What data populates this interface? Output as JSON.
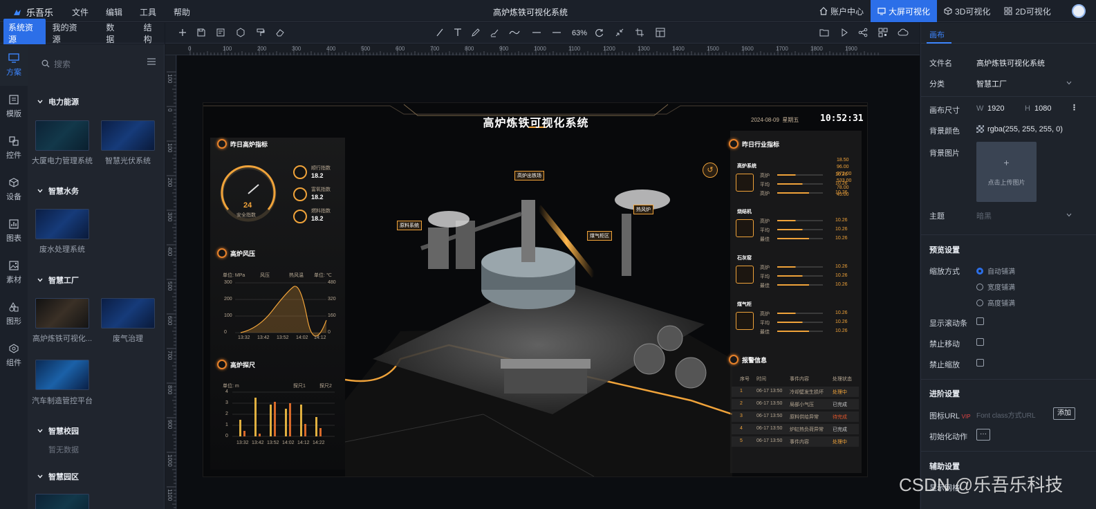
{
  "app": {
    "logo_text": "乐吾乐",
    "title": "高炉炼铁可视化系统"
  },
  "menu": [
    "文件",
    "编辑",
    "工具",
    "帮助"
  ],
  "top_right": {
    "account": "账户中心",
    "bigscreen": "大屏可视化",
    "v3d": "3D可视化",
    "v2d": "2D可视化"
  },
  "left_tabs": [
    "系统资源",
    "我的资源",
    "数据",
    "结构"
  ],
  "rail": [
    "方案",
    "模版",
    "控件",
    "设备",
    "图表",
    "素材",
    "图形",
    "组件"
  ],
  "search": {
    "placeholder": "搜索"
  },
  "categories": {
    "power": {
      "name": "电力能源",
      "items": [
        "大厦电力管理系统",
        "智慧光伏系统"
      ]
    },
    "water": {
      "name": "智慧水务",
      "items": [
        "废水处理系统"
      ]
    },
    "factory": {
      "name": "智慧工厂",
      "items": [
        "高炉炼铁可视化...",
        "废气治理",
        "汽车制造管控平台"
      ]
    },
    "campus": {
      "name": "智慧校园",
      "empty": "暂无数据"
    },
    "park": {
      "name": "智慧园区"
    }
  },
  "toolbar": {
    "zoom": "63%"
  },
  "ruler": {
    "h": [
      "0",
      "100",
      "200",
      "300",
      "400",
      "500",
      "600",
      "700",
      "800",
      "900",
      "1000",
      "1100",
      "1200",
      "1300",
      "1400",
      "1500",
      "1600",
      "1700",
      "1800",
      "1900"
    ],
    "v": [
      "100",
      "0",
      "100",
      "200",
      "300",
      "400",
      "500",
      "600",
      "700",
      "800",
      "900",
      "1000",
      "1100"
    ]
  },
  "dashboard": {
    "title": "高炉炼铁可视化系统",
    "date": "2024-08-09",
    "weekday": "星期五",
    "time": "10:52:31",
    "p1": {
      "title": "昨日高炉指标",
      "gauge_value": "24",
      "gauge_label": "安全指数",
      "metrics": [
        {
          "label": "顺行指数",
          "value": "18.2"
        },
        {
          "label": "富氧指数",
          "value": "18.2"
        },
        {
          "label": "燃料指数",
          "value": "18.2"
        }
      ]
    },
    "p2": {
      "title": "高炉风压",
      "unit_left": "单位: MPa",
      "unit_right": "单位: ℃",
      "legend": [
        "风压",
        "热风温"
      ],
      "yleft": [
        "300",
        "200",
        "100",
        "0"
      ],
      "yright": [
        "480",
        "320",
        "160",
        "0"
      ],
      "x": [
        "13:32",
        "13:42",
        "13:52",
        "14:02",
        "14:12"
      ]
    },
    "p3": {
      "title": "高炉探尺",
      "unit": "单位: m",
      "legend": [
        "探尺1",
        "探尺2"
      ],
      "y": [
        "4",
        "3",
        "2",
        "1",
        "0"
      ],
      "x": [
        "13:32",
        "13:42",
        "13:52",
        "14:02",
        "14:12",
        "14:22"
      ]
    },
    "right": {
      "title": "昨日行业指标",
      "groups": [
        {
          "name": "高炉系统",
          "rows": [
            {
              "k": "高炉",
              "v": "10.26"
            },
            {
              "k": "平均",
              "v": "10.26"
            },
            {
              "k": "高炉",
              "v": "10.26"
            }
          ]
        },
        {
          "name": "烧结机",
          "rows": [
            {
              "k": "高炉",
              "v": "10.26"
            },
            {
              "k": "平均",
              "v": "10.26"
            },
            {
              "k": "最佳",
              "v": "10.26"
            }
          ]
        },
        {
          "name": "石灰窑",
          "rows": [
            {
              "k": "高炉",
              "v": "10.26"
            },
            {
              "k": "平均",
              "v": "10.26"
            },
            {
              "k": "最佳",
              "v": "10.26"
            }
          ]
        },
        {
          "name": "煤气柜",
          "rows": [
            {
              "k": "高炉",
              "v": "10.26"
            },
            {
              "k": "平均",
              "v": "10.26"
            },
            {
              "k": "最佳",
              "v": "10.26"
            }
          ]
        }
      ],
      "side_values": [
        "18.50",
        "96.00",
        "972.00",
        "533.00",
        "78.00",
        "45.00"
      ]
    },
    "alarm": {
      "title": "报警信息",
      "headers": [
        "序号",
        "时间",
        "事件内容",
        "处理状态"
      ],
      "rows": [
        {
          "n": "1",
          "t": "06-17 13:50",
          "c": "冷却壁发生损坏",
          "s": "处理中"
        },
        {
          "n": "2",
          "t": "06-17 13:50",
          "c": "局部小气压",
          "s": "已完成"
        },
        {
          "n": "3",
          "t": "06-17 13:50",
          "c": "原料供给异常",
          "s": "待完成"
        },
        {
          "n": "4",
          "t": "06-17 13:50",
          "c": "炉缸热负荷异常",
          "s": "已完成"
        },
        {
          "n": "5",
          "t": "06-17 13:50",
          "c": "事件内容",
          "s": "处理中"
        }
      ]
    },
    "labels": [
      "高炉出铁场",
      "热风炉",
      "原料系统",
      "煤气柜区"
    ]
  },
  "props": {
    "tab": "画布",
    "file_label": "文件名",
    "file_value": "高炉炼铁可视化系统",
    "cat_label": "分类",
    "cat_value": "智慧工厂",
    "size_label": "画布尺寸",
    "w_label": "W",
    "w_value": "1920",
    "h_label": "H",
    "h_value": "1080",
    "bg_label": "背景颜色",
    "bg_value": "rgba(255, 255, 255, 0)",
    "bgimg_label": "背景图片",
    "upload_text": "点击上传图片",
    "theme_label": "主题",
    "theme_value": "暗黑",
    "preview": "预览设置",
    "scale_label": "缩放方式",
    "scale_options": [
      "自动铺满",
      "宽度铺满",
      "高度铺满"
    ],
    "scroll_label": "显示滚动条",
    "nomove_label": "禁止移动",
    "nozoom_label": "禁止缩放",
    "advanced": "进阶设置",
    "icon_url_label": "图标URL",
    "vip": "VIP",
    "icon_url_placeholder": "Font class方式URL",
    "add": "添加",
    "init_label": "初始化动作",
    "more": "···",
    "aux": "辅助设置",
    "grid_label": "显示网格"
  },
  "watermark": "CSDN @乐吾乐科技",
  "colors": {
    "accent": "#2c6fe8",
    "dash_orange": "#f0a33a"
  }
}
